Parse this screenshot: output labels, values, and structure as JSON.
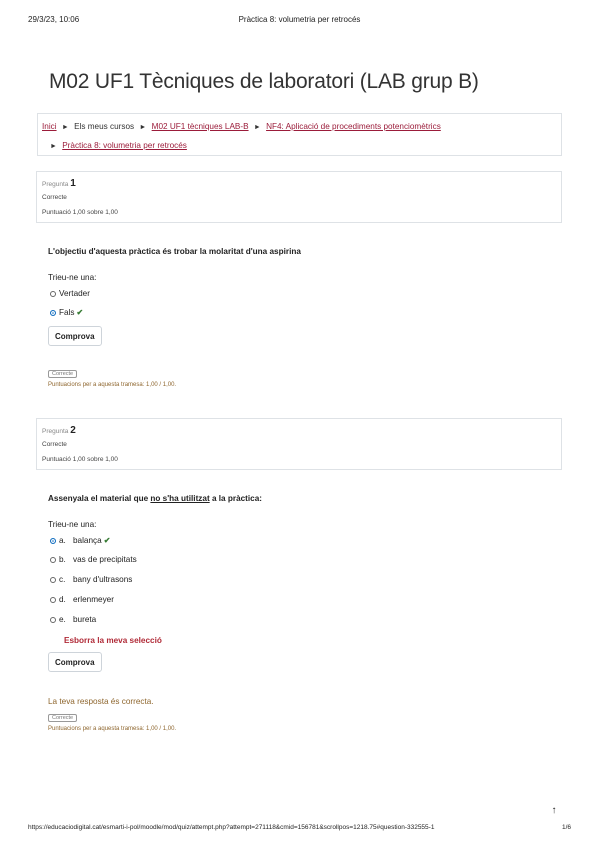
{
  "header": {
    "date": "29/3/23, 10:06",
    "title": "Pràctica 8: volumetria per retrocés"
  },
  "course_title": "M02 UF1 Tècniques de laboratori (LAB grup B)",
  "breadcrumb": {
    "home": "Inici",
    "my_courses": "Els meus cursos",
    "course": "M02 UF1 tècniques LAB-B",
    "section": "NF4: Aplicació de procediments potenciomètrics",
    "activity": "Pràctica 8: volumetria per retrocés",
    "separator": "►"
  },
  "q1": {
    "label": "Pregunta",
    "number": "1",
    "state": "Correcte",
    "mark": "Puntuació 1,00 sobre 1,00",
    "text": "L'objectiu d'aquesta pràctica és trobar la molaritat d'una aspirina",
    "prompt": "Trieu-ne una:",
    "options": [
      "Vertader",
      "Fals"
    ],
    "check": "✔",
    "button": "Comprova",
    "state_badge": "Correcte",
    "score_text": "Puntuacions per a aquesta tramesa: 1,00 / 1,00."
  },
  "q2": {
    "label": "Pregunta",
    "number": "2",
    "state": "Correcte",
    "mark": "Puntuació 1,00 sobre 1,00",
    "text_before": "Assenyala el material que ",
    "text_underlined": "no s'ha utilitzat",
    "text_after": " a la pràctica:",
    "prompt": "Trieu-ne una:",
    "options": [
      {
        "letter": "a.",
        "text": "balança"
      },
      {
        "letter": "b.",
        "text": "vas de precipitats"
      },
      {
        "letter": "c.",
        "text": "bany d'ultrasons"
      },
      {
        "letter": "d.",
        "text": "erlenmeyer"
      },
      {
        "letter": "e.",
        "text": "bureta"
      }
    ],
    "check": "✔",
    "clear": "Esborra la meva selecció",
    "button": "Comprova",
    "feedback": "La teva resposta és correcta.",
    "state_badge": "Correcte",
    "score_text": "Puntuacions per a aquesta tramesa: 1,00 / 1,00."
  },
  "footer": {
    "url": "https://educaciodigital.cat/esmarti-i-pol/moodle/mod/quiz/attempt.php?attempt=271118&cmid=156781&scrollpos=1218.75#question-332555-1",
    "page": "1/6",
    "up_icon": "↑"
  }
}
